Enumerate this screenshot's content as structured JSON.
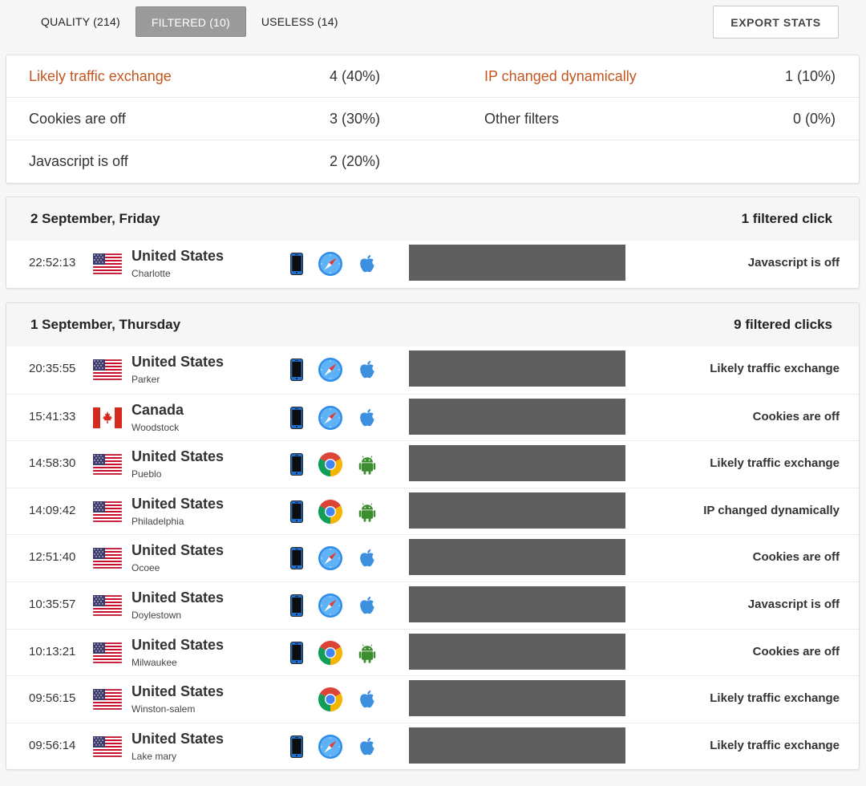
{
  "tabs": [
    {
      "label": "QUALITY (214)",
      "active": false
    },
    {
      "label": "FILTERED (10)",
      "active": true
    },
    {
      "label": "USELESS (14)",
      "active": false
    }
  ],
  "export_label": "EXPORT STATS",
  "summary": {
    "rows": [
      [
        {
          "label": "Likely traffic exchange",
          "value": "4 (40%)",
          "highlight": true
        },
        {
          "label": "IP changed dynamically",
          "value": "1 (10%)",
          "highlight": true
        }
      ],
      [
        {
          "label": "Cookies are off",
          "value": "3 (30%)",
          "highlight": false
        },
        {
          "label": "Other filters",
          "value": "0 (0%)",
          "highlight": false
        }
      ],
      [
        {
          "label": "Javascript is off",
          "value": "2 (20%)",
          "highlight": false
        }
      ]
    ],
    "highlight_color": "#c3561f"
  },
  "groups": [
    {
      "date": "2 September, Friday",
      "count": "1 filtered click",
      "rows": [
        {
          "time": "22:52:13",
          "flag": "us-flag-icon",
          "country": "United States",
          "city": "Charlotte",
          "device": "mobile-phone-icon",
          "browser": "safari-icon",
          "os": "apple-icon",
          "reason": "Javascript is off"
        }
      ]
    },
    {
      "date": "1 September, Thursday",
      "count": "9 filtered clicks",
      "rows": [
        {
          "time": "20:35:55",
          "flag": "us-flag-icon",
          "country": "United States",
          "city": "Parker",
          "device": "mobile-phone-icon",
          "browser": "safari-icon",
          "os": "apple-icon",
          "reason": "Likely traffic exchange"
        },
        {
          "time": "15:41:33",
          "flag": "ca-flag-icon",
          "country": "Canada",
          "city": "Woodstock",
          "device": "mobile-phone-icon",
          "browser": "safari-icon",
          "os": "apple-icon",
          "reason": "Cookies are off"
        },
        {
          "time": "14:58:30",
          "flag": "us-flag-icon",
          "country": "United States",
          "city": "Pueblo",
          "device": "mobile-phone-icon",
          "browser": "chrome-icon",
          "os": "android-icon",
          "reason": "Likely traffic exchange"
        },
        {
          "time": "14:09:42",
          "flag": "us-flag-icon",
          "country": "United States",
          "city": "Philadelphia",
          "device": "mobile-phone-icon",
          "browser": "chrome-icon",
          "os": "android-icon",
          "reason": "IP changed dynamically"
        },
        {
          "time": "12:51:40",
          "flag": "us-flag-icon",
          "country": "United States",
          "city": "Ocoee",
          "device": "mobile-phone-icon",
          "browser": "safari-icon",
          "os": "apple-icon",
          "reason": "Cookies are off"
        },
        {
          "time": "10:35:57",
          "flag": "us-flag-icon",
          "country": "United States",
          "city": "Doylestown",
          "device": "mobile-phone-icon",
          "browser": "safari-icon",
          "os": "apple-icon",
          "reason": "Javascript is off"
        },
        {
          "time": "10:13:21",
          "flag": "us-flag-icon",
          "country": "United States",
          "city": "Milwaukee",
          "device": "mobile-phone-icon",
          "browser": "chrome-icon",
          "os": "android-icon",
          "reason": "Cookies are off"
        },
        {
          "time": "09:56:15",
          "flag": "us-flag-icon",
          "country": "United States",
          "city": "Winston-salem",
          "device": "",
          "browser": "chrome-icon",
          "os": "apple-icon",
          "reason": "Likely traffic exchange"
        },
        {
          "time": "09:56:14",
          "flag": "us-flag-icon",
          "country": "United States",
          "city": "Lake mary",
          "device": "mobile-phone-icon",
          "browser": "safari-icon",
          "os": "apple-icon",
          "reason": "Likely traffic exchange"
        }
      ]
    }
  ]
}
